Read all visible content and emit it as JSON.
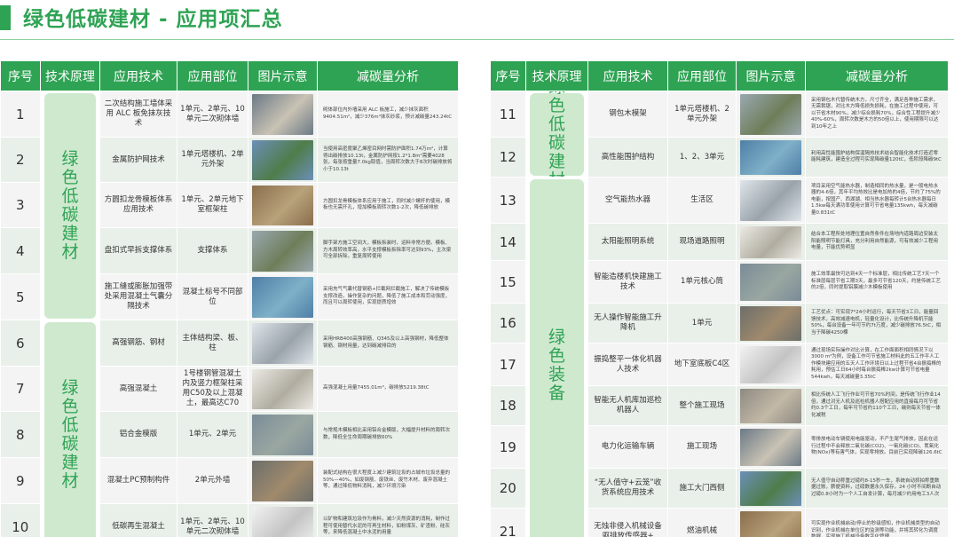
{
  "page": {
    "title": "绿色低碳建材 - 应用项汇总"
  },
  "headers": {
    "no": "序号",
    "principle": "技术原理",
    "tech": "应用技术",
    "part": "应用部位",
    "image": "图片示意",
    "analysis": "减碳量分析"
  },
  "left": {
    "categories": [
      "绿色低碳建材",
      "绿色低碳建材"
    ],
    "rows": [
      {
        "no": "1",
        "tech": "二次结构施工墙体采用 ALC 板免抹灰技术",
        "part": "1单元、2单元、10单元二次砌体墙",
        "analysis": "砌体部位内外墙采用 ALC 板施工，减少抹灰面积9404.51m²，减少376m³抹灰砂浆，预计减碳量243.24tC"
      },
      {
        "no": "2",
        "tech": "金属防护网技术",
        "part": "1单元塔楼机、2单元外架",
        "analysis": "当使用高密度聚乙烯密目网时需防护面积1.74万m²，计算得出碳排放10.13t，金属防护网按1.2*1.8m²需要4028张，每张按重量7.0kg取值，当周转次数大于8次时碳排放将小于10.13t"
      },
      {
        "no": "3",
        "tech": "方圆扣龙骨模板体系应用技术",
        "part": "1单元、2单元地下室框架柱",
        "analysis": "方圆扣龙骨模板体系应用于施工，同时减少螺杆的使用，模板也无需开孔，增加模板周转次数1-2次，降低碳排放"
      },
      {
        "no": "4",
        "tech": "盘扣式早拆支撑体系",
        "part": "支撑体系",
        "analysis": "脚手架方施工空间大，模板拆装时，运料非常方便。模板、方木周转效率高，水平支撑模板拆除率可达到93%，主次梁可全部拆除，重复周转使用"
      },
      {
        "no": "5",
        "tech": "施工缝或膨胀加强带处采用混凝土气囊分隔技术",
        "part": "混凝土标号不同部位",
        "analysis": "采用充气气囊代替钢筋+拦截网拦截施工，解决了传统模板支撑改造，操作复杂的问题，降低了施工成本和劳动强度，而且可以周转使用，实现提质增效"
      },
      {
        "no": "6",
        "tech": "高强钢筋、钢材",
        "part": "主体结构梁、板、柱",
        "analysis": "采用HRB400高强钢筋、Q345及以上高强钢材，降低整体钢筋、钢材用量，达到碳减排目的"
      },
      {
        "no": "7",
        "tech": "高强混凝土",
        "part": "1号楼钢管混凝土内及竖力框架柱采用C50及以上混凝土，最高达C70",
        "analysis": "高强混凝土用量7455.01m³，碳排放5219.38tC"
      },
      {
        "no": "8",
        "tech": "铝合金模版",
        "part": "1单元、2单元",
        "analysis": "与常规木模板相比采用铝合金模版，大幅提升材料的周转次数，降低全生命周期碳排放60%"
      },
      {
        "no": "9",
        "tech": "混凝土PC预制构件",
        "part": "2单元外墙",
        "analysis": "装配式结构在很大程度上减少建筑垃圾的占城市垃圾总量的50%—40%，如废钢筋、废铁丝、废竹木材、废弃混凝土等，通过降低物料消耗，减少环境污染"
      },
      {
        "no": "10",
        "tech": "低碳再生混凝土",
        "part": "1单元、2单元、10单元二次砌体墙",
        "analysis": "以矿物和建筑垃圾作为骨料，减少天然资源的消耗，制作过程可使用替代水泥的可再生材料，如粉煤灰、矿渣粉、硅灰等，来降低混凝土中水泥的用量"
      }
    ]
  },
  "right": {
    "categories": [
      "绿色低碳建材",
      "绿色装备"
    ],
    "rows": [
      {
        "no": "11",
        "tech": "钢包木模架",
        "part": "1单元塔楼机、2单元外架",
        "analysis": "采用钢包木代替传统木方，尺寸齐全，满足各种施工需求，无需裁锯，对比木方降低损失损耗，在施工过程中使用，可以节省木材90%，减少综合损耗70%，综合性工程提升减少40%-60%，周转次数是木方的50倍以上，使用期限可以达到10年之上"
      },
      {
        "no": "12",
        "tech": "高性能围护结构",
        "part": "1、2、3单元",
        "analysis": "利用高性能围护结构保温隔热技术结合智能化技术打造近零能耗建筑，建造全过程可实现降碳量120tC，低阶段降碳9tC"
      },
      {
        "no": "13",
        "tech": "空气能热水器",
        "part": "生活区",
        "analysis": "项目采用空气能热水器，制造相同的热水量，是一般电热水器的4-6倍，其年平均热效比是电加热的4倍，节约了75%的电能，按国产、西湖湖、相当热水器每转计5台热水器每日1.5kw每天满功率使用计算可节省电量135kwh，每天减碳量0.831tC"
      },
      {
        "no": "14",
        "tech": "太阳能照明系统",
        "part": "现场道路照明",
        "analysis": "结合本工程所处地理位置自然条件在场地内道路周边安装太阳能照明节能灯具，充分利用自然能源，可有效减少工程用电量，节能优势明显"
      },
      {
        "no": "15",
        "tech": "智能造楼机快建施工技术",
        "part": "1单元核心筒",
        "analysis": "施工效率最快可达到4天一个标准层，相比传统工艺7天一个标准层每层节省工期3天，最多可节省120天，约是传统工艺的2倍，同时提取铝膜减少木模板使用"
      },
      {
        "no": "16",
        "tech": "无人操作智能施工升降机",
        "part": "1单元",
        "analysis": "工艺优点：可实现7*24小时运行，每天节省3工日，能量回馈技术，高效减速电机，轻量化设计，比传统升降机节能50%，每台设备一年可节约7t万度，减少碳排放76.5tC，相当于降碳4250棵"
      },
      {
        "no": "17",
        "tech": "振捣整平一体化机器人技术",
        "part": "地下室底板C4区",
        "analysis": "通过现场实际操作对比计算，在工作面面积相同情况下以3000 m³为例，设备工作可节省施工材料此的五工作平人工作模块建应用的五天人工作环境日以上过程节省4台振捣棒的耗用，预估工日64小时每台振捣棒2kw计算可节省电量544kwh，每天减碳量3.35tC"
      },
      {
        "no": "18",
        "tech": "智能无人机库加巡检机器人",
        "part": "整个施工现场",
        "analysis": "相比传统人工飞行作业可节省70%时间，是传统飞行作业14倍，通过对无人机及巡检机器人搭配应用的直接每月可节省约0.3个工日，每年可节省约110个工日，碳则每天节省一体化减税"
      },
      {
        "no": "19",
        "tech": "电力化运输车辆",
        "part": "施工现场",
        "analysis": "零排放电动车辆使用电能驱动，不产生尾气排放，因此在运行过程中不会释放二氧化碳(CO2)、一氧化碳(CO)、氮氧化物(NOx)等有害气体，实现零排放。目前已实现降碳126.6tC"
      },
      {
        "no": "20",
        "tech": "“无人值守+云笼”收货系统应用技术",
        "part": "施工大门西侧",
        "analysis": "无人值守自动称重过磅约8-15秒一车，系统自动抓拍称重数据过账，薪便资料，过磅数据永久保存，24 小时不间断自动过磅0.8小时为一个人工自发计算，每月减少约用电工3人次"
      },
      {
        "no": "21",
        "tech": "无烛非侵入机械设备驱排放传感器+",
        "part": "燃油机械",
        "analysis": "可实现作业机械启动/停止的秒级感知，作业机械类型的自动识别，作业机械在单位区的监测等功能，并将其转化为调度数据，实现施工机械设备数字化管理"
      }
    ]
  }
}
